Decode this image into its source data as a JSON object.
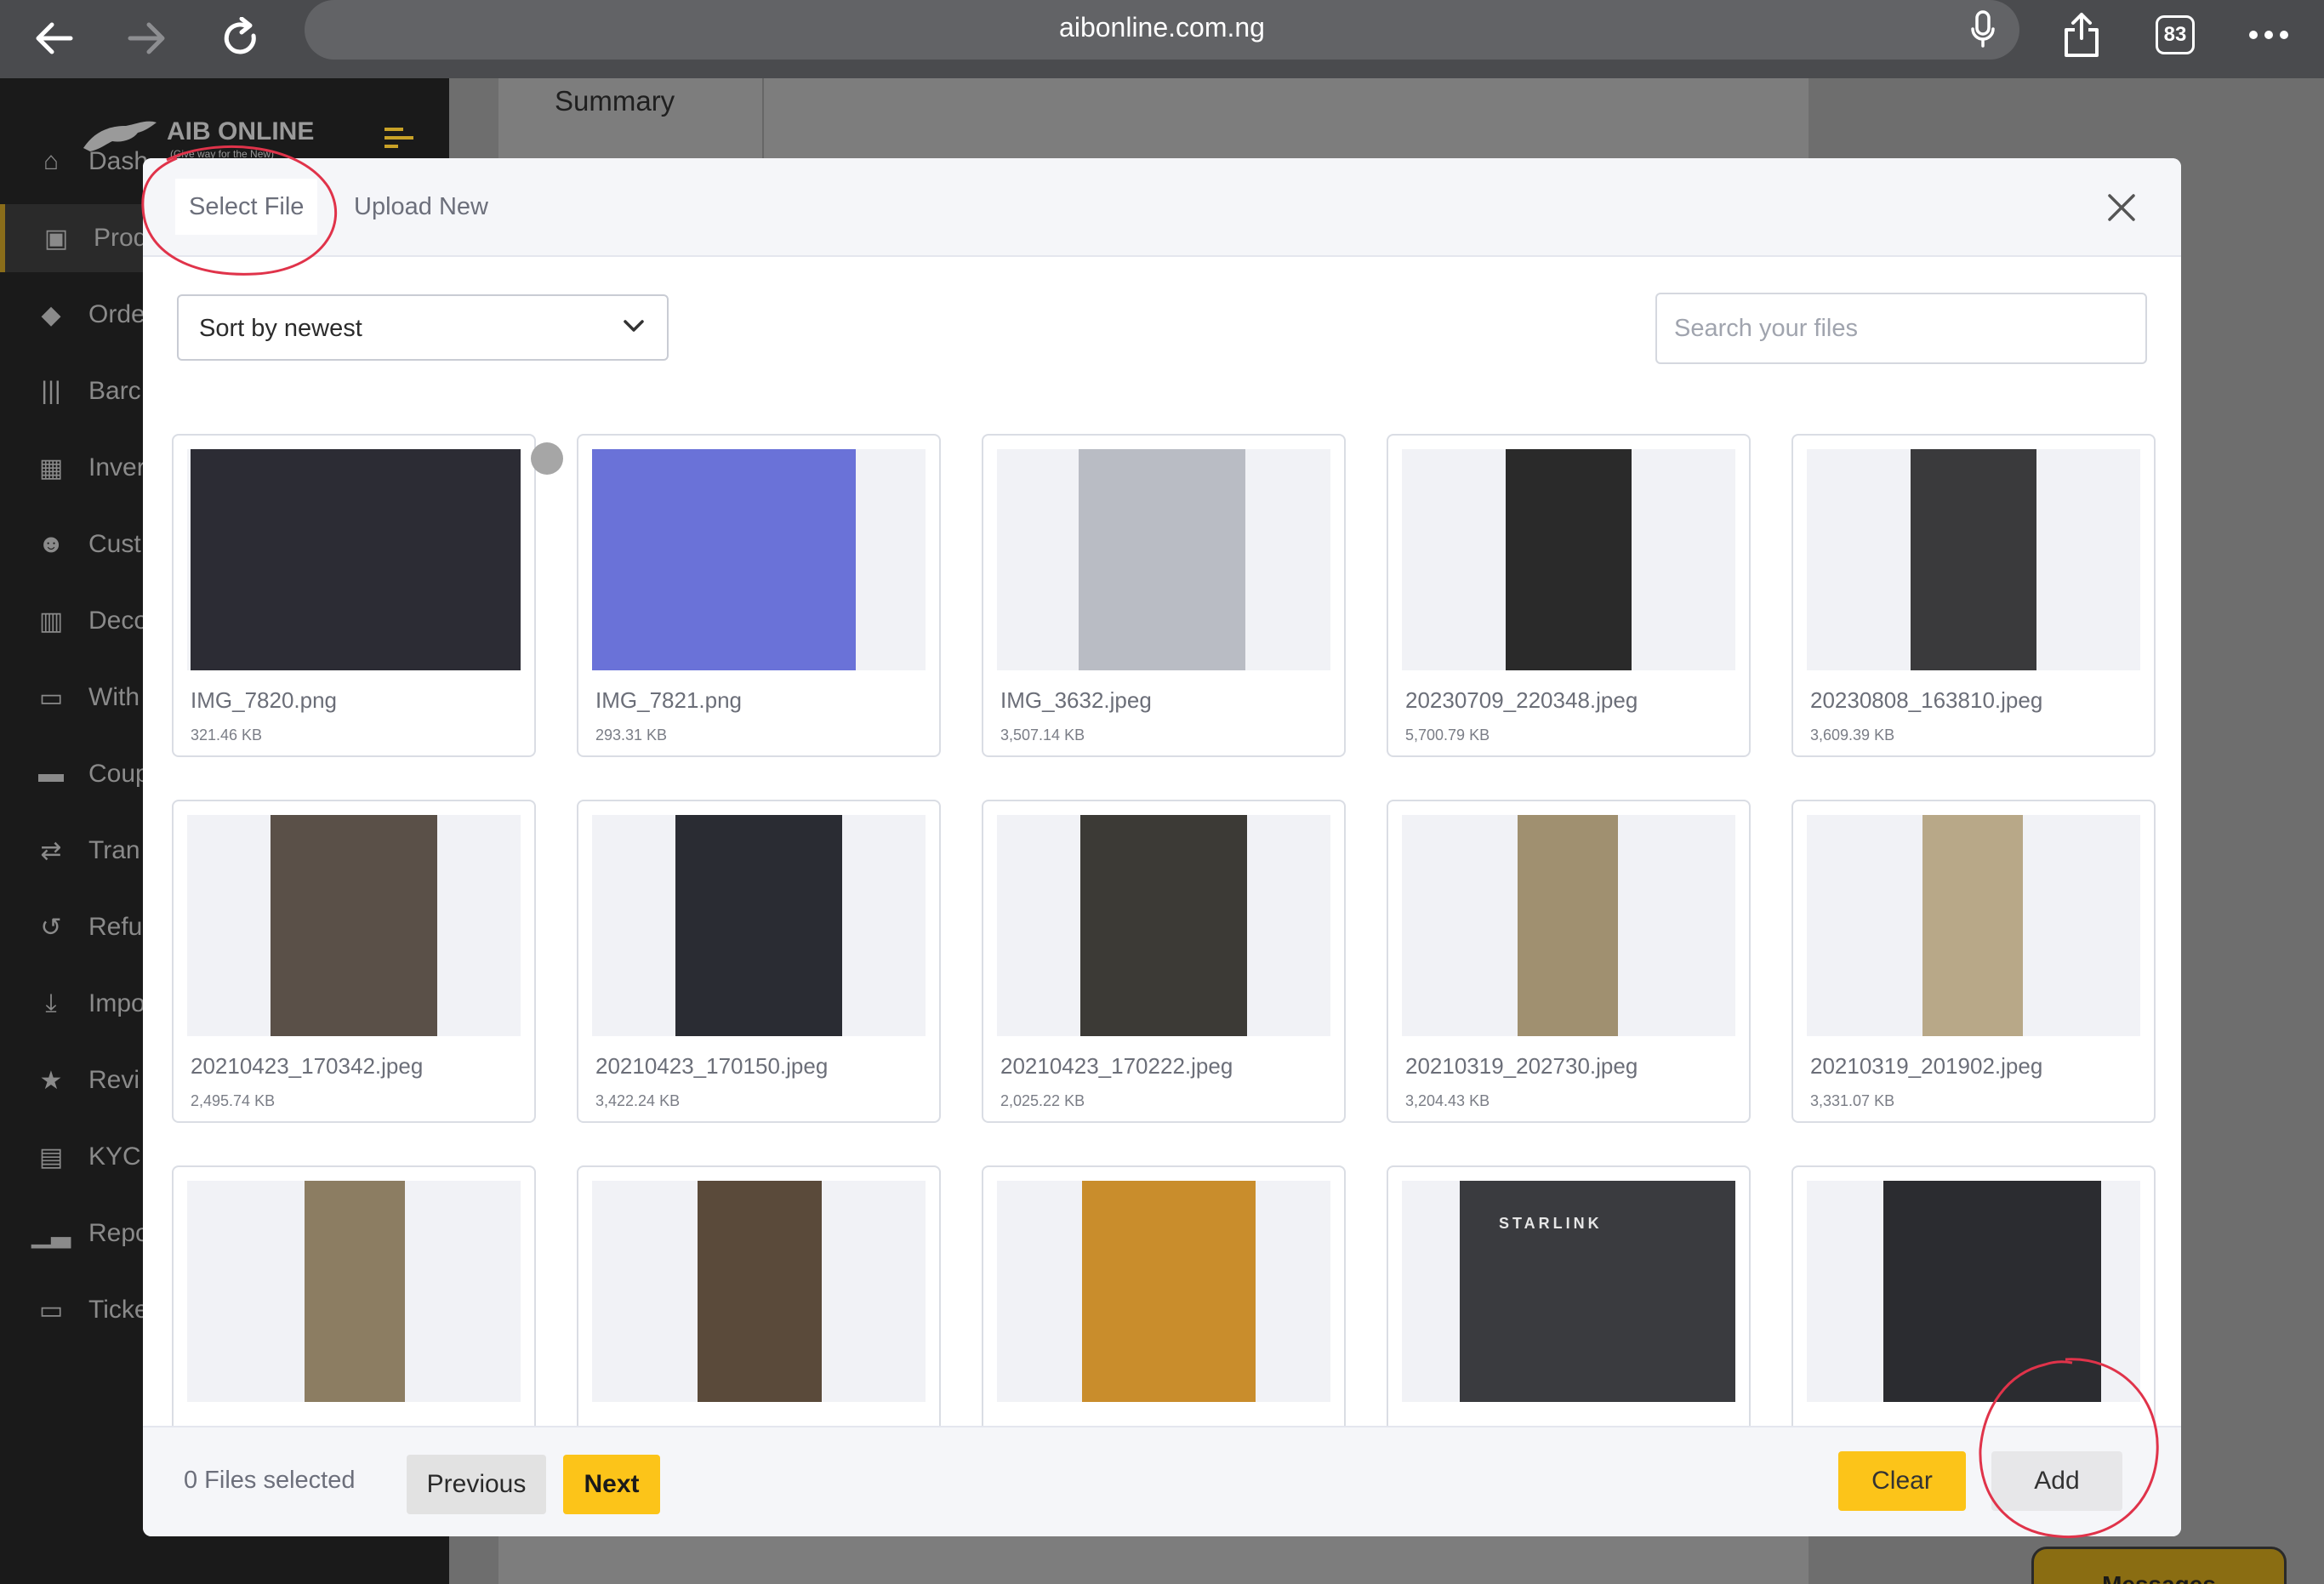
{
  "browser": {
    "url": "aibonline.com.ng",
    "tab_count": "83"
  },
  "sidebar": {
    "logo_title": "AIB ONLINE",
    "logo_tagline": "(Give way for the New)",
    "items": [
      {
        "label": "Dash",
        "icon": "home-icon"
      },
      {
        "label": "Prod",
        "icon": "box-icon"
      },
      {
        "label": "Orde",
        "icon": "bag-icon"
      },
      {
        "label": "Barc",
        "icon": "barcode-icon"
      },
      {
        "label": "Inver",
        "icon": "table-icon"
      },
      {
        "label": "Cust",
        "icon": "users-icon"
      },
      {
        "label": "Deco",
        "icon": "building-icon"
      },
      {
        "label": "With",
        "icon": "card-icon"
      },
      {
        "label": "Coup",
        "icon": "coupon-icon"
      },
      {
        "label": "Tran",
        "icon": "transfer-icon"
      },
      {
        "label": "Refu",
        "icon": "refund-icon"
      },
      {
        "label": "Impo",
        "icon": "download-icon"
      },
      {
        "label": "Revi",
        "icon": "star-icon"
      },
      {
        "label": "KYC",
        "icon": "id-card-icon"
      },
      {
        "label": "Repo",
        "icon": "chart-icon"
      },
      {
        "label": "Ticke",
        "icon": "ticket-icon"
      }
    ]
  },
  "background": {
    "summary_label": "Summary",
    "messages_label": "Messages"
  },
  "modal": {
    "tabs": {
      "select_file": "Select File",
      "upload_new": "Upload New"
    },
    "sort_label": "Sort by newest",
    "search_placeholder": "Search your files",
    "files": [
      {
        "name": "IMG_7820.png",
        "size": "321.46 KB"
      },
      {
        "name": "IMG_7821.png",
        "size": "293.31 KB"
      },
      {
        "name": "IMG_3632.jpeg",
        "size": "3,507.14 KB"
      },
      {
        "name": "20230709_220348.jpeg",
        "size": "5,700.79 KB"
      },
      {
        "name": "20230808_163810.jpeg",
        "size": "3,609.39 KB"
      },
      {
        "name": "20210423_170342.jpeg",
        "size": "2,495.74 KB"
      },
      {
        "name": "20210423_170150.jpeg",
        "size": "3,422.24 KB"
      },
      {
        "name": "20210423_170222.jpeg",
        "size": "2,025.22 KB"
      },
      {
        "name": "20210319_202730.jpeg",
        "size": "3,204.43 KB"
      },
      {
        "name": "20210319_201902.jpeg",
        "size": "3,331.07 KB"
      },
      {
        "name": "",
        "size": ""
      },
      {
        "name": "",
        "size": ""
      },
      {
        "name": "",
        "size": ""
      },
      {
        "name": "",
        "size": "",
        "photo_text": "STARLINK"
      },
      {
        "name": "",
        "size": ""
      }
    ],
    "footer": {
      "files_selected": "0 Files selected",
      "previous": "Previous",
      "next": "Next",
      "clear": "Clear",
      "add": "Add"
    }
  },
  "colors": {
    "accent_yellow": "#fcc419",
    "annotation_red": "#e0334a"
  }
}
